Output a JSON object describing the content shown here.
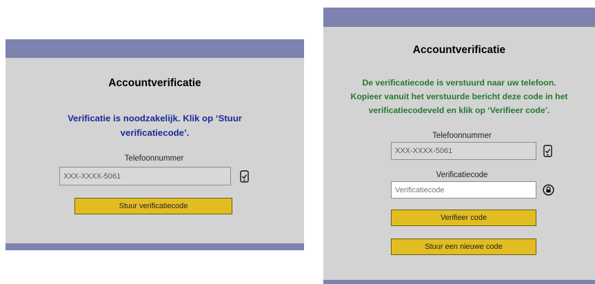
{
  "left_form": {
    "title": "Accountverificatie",
    "message_line1": "Verificatie is noodzakelijk. Klik op ‘Stuur",
    "message_line2": "verificatiecode’.",
    "phone_label": "Telefoonnummer",
    "phone_value": "XXX-XXXX-5061",
    "send_button_label": "Stuur verificatiecode",
    "colors": {
      "header_bar": "#7d82ae",
      "panel": "#d3d3d3",
      "message": "#1b2a9c",
      "button": "#e2bd22"
    }
  },
  "right_form": {
    "title": "Accountverificatie",
    "message_line1": "De verificatiecode is verstuurd naar uw telefoon.",
    "message_line2": "Kopieer vanuit het verstuurde bericht deze code in het",
    "message_line3": "verificatiecodeveld en klik op ‘Verifieer code’.",
    "phone_label": "Telefoonnummer",
    "phone_value": "XXX-XXXX-5061",
    "code_label": "Verificatiecode",
    "code_placeholder": "Verificatiecode",
    "verify_button_label": "Verifieer code",
    "resend_button_label": "Stuur een nieuwe code",
    "colors": {
      "message": "#247a2e"
    }
  },
  "icons": {
    "phone": "phone-check-icon",
    "lock": "lock-circle-icon"
  }
}
